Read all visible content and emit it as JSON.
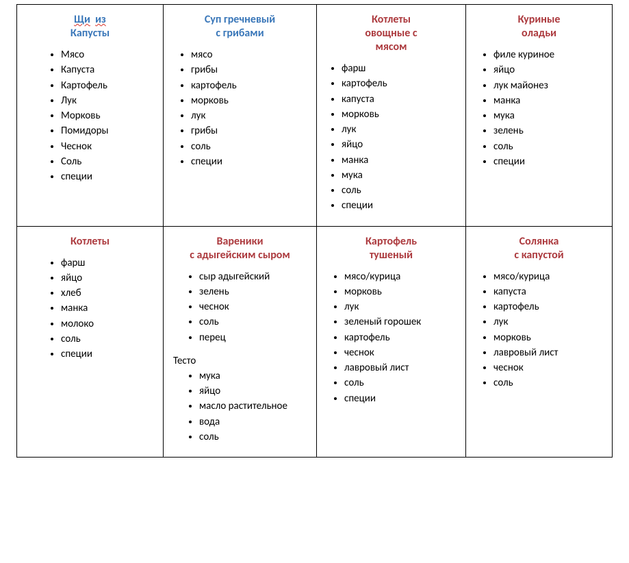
{
  "recipes": {
    "r0": {
      "title_1": "Щи",
      "title_2": "из",
      "title_3": "Капусты",
      "ing": [
        "Мясо",
        "Капуста",
        "Картофель",
        "Лук",
        "Морковь",
        "Помидоры",
        "Чеснок",
        "Соль",
        "специи"
      ]
    },
    "r1": {
      "title_1": "Суп гречневый",
      "title_2": "с грибами",
      "ing": [
        "мясо",
        "грибы",
        "картофель",
        "морковь",
        "лук",
        "грибы",
        "соль",
        "специи"
      ]
    },
    "r2": {
      "title_1": "Котлеты",
      "title_2": "овощные с",
      "title_3": "мясом",
      "ing": [
        "фарш",
        "картофель",
        "капуста",
        "морковь",
        "лук",
        "яйцо",
        "манка",
        "мука",
        "соль",
        "специи"
      ]
    },
    "r3": {
      "title_1": "Куриные",
      "title_2": "оладьи",
      "ing": [
        "филе куриное",
        "яйцо",
        "лук майонез",
        "манка",
        "мука",
        "зелень",
        "соль",
        "специи"
      ]
    },
    "r4": {
      "title_1": "Котлеты",
      "ing": [
        "фарш",
        "яйцо",
        "хлеб",
        "манка",
        "молоко",
        "соль",
        "специи"
      ]
    },
    "r5": {
      "title_1": "Вареники",
      "title_2": "с адыгейским сыром",
      "ing": [
        "сыр адыгейский",
        "зелень",
        "чеснок",
        "соль",
        "перец"
      ],
      "sub": "Тесто",
      "ing2": [
        "мука",
        "яйцо",
        "масло растительное",
        "вода",
        "соль"
      ]
    },
    "r6": {
      "title_1": "Картофель",
      "title_2": "тушеный",
      "ing": [
        "мясо/курица",
        "морковь",
        "лук",
        "зеленый горошек",
        "картофель",
        "чеснок",
        "лавровый лист",
        "соль",
        "специи"
      ]
    },
    "r7": {
      "title_1": "Солянка",
      "title_2": "с капустой",
      "ing": [
        "мясо/курица",
        "капуста",
        "картофель",
        "лук",
        "морковь",
        "лавровый лист",
        "чеснок",
        "соль"
      ]
    }
  }
}
